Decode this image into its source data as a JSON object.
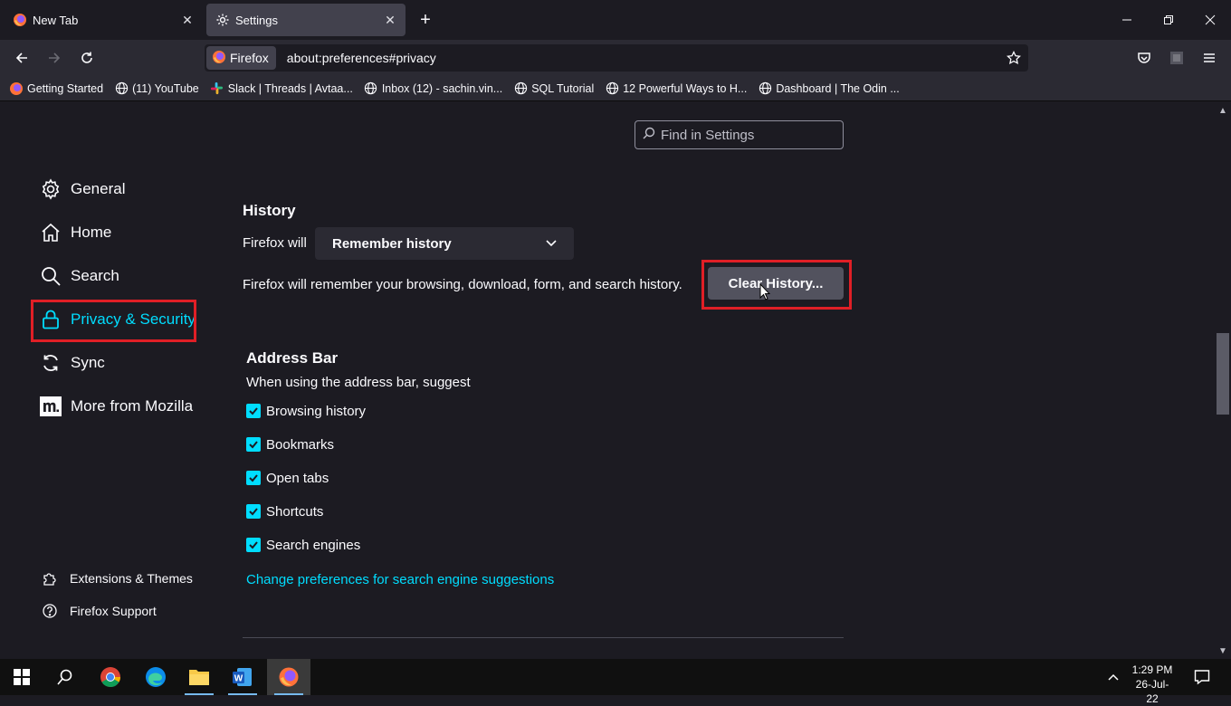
{
  "tabs": [
    {
      "title": "New Tab",
      "icon": "firefox-icon",
      "active": false
    },
    {
      "title": "Settings",
      "icon": "gear-icon",
      "active": true
    }
  ],
  "window_controls": [
    "minimize-icon",
    "maximize-icon",
    "close-icon"
  ],
  "navbar": {
    "identity_label": "Firefox",
    "url": "about:preferences#privacy"
  },
  "bookmarks": [
    {
      "label": "Getting Started",
      "icon": "firefox-icon"
    },
    {
      "label": "(11) YouTube",
      "icon": "globe-icon"
    },
    {
      "label": "Slack | Threads | Avtaa...",
      "icon": "slack-icon"
    },
    {
      "label": "Inbox (12) - sachin.vin...",
      "icon": "globe-icon"
    },
    {
      "label": "SQL Tutorial",
      "icon": "globe-icon"
    },
    {
      "label": "12 Powerful Ways to H...",
      "icon": "globe-icon"
    },
    {
      "label": "Dashboard | The Odin ...",
      "icon": "globe-icon"
    }
  ],
  "search": {
    "placeholder": "Find in Settings"
  },
  "sidebar": {
    "items": [
      {
        "label": "General",
        "icon": "gear-icon"
      },
      {
        "label": "Home",
        "icon": "home-icon"
      },
      {
        "label": "Search",
        "icon": "search-icon"
      },
      {
        "label": "Privacy & Security",
        "icon": "lock-icon",
        "selected": true
      },
      {
        "label": "Sync",
        "icon": "sync-icon"
      },
      {
        "label": "More from Mozilla",
        "icon": "mozilla-icon"
      }
    ],
    "footer": [
      {
        "label": "Extensions & Themes",
        "icon": "puzzle-icon"
      },
      {
        "label": "Firefox Support",
        "icon": "help-icon"
      }
    ]
  },
  "history": {
    "heading": "History",
    "firefox_will_label": "Firefox will",
    "mode_value": "Remember history",
    "description": "Firefox will remember your browsing, download, form, and search history.",
    "clear_button": "Clear History..."
  },
  "address_bar": {
    "heading": "Address Bar",
    "intro": "When using the address bar, suggest",
    "options": [
      {
        "label": "Browsing history",
        "checked": true
      },
      {
        "label": "Bookmarks",
        "checked": true
      },
      {
        "label": "Open tabs",
        "checked": true
      },
      {
        "label": "Shortcuts",
        "checked": true
      },
      {
        "label": "Search engines",
        "checked": true
      }
    ],
    "change_link": "Change preferences for search engine suggestions"
  },
  "taskbar": {
    "time": "1:29 PM",
    "date": "26-Jul-22"
  },
  "colors": {
    "accent": "#00ddff",
    "highlight_box": "#e01f26",
    "background": "#1c1b22"
  }
}
